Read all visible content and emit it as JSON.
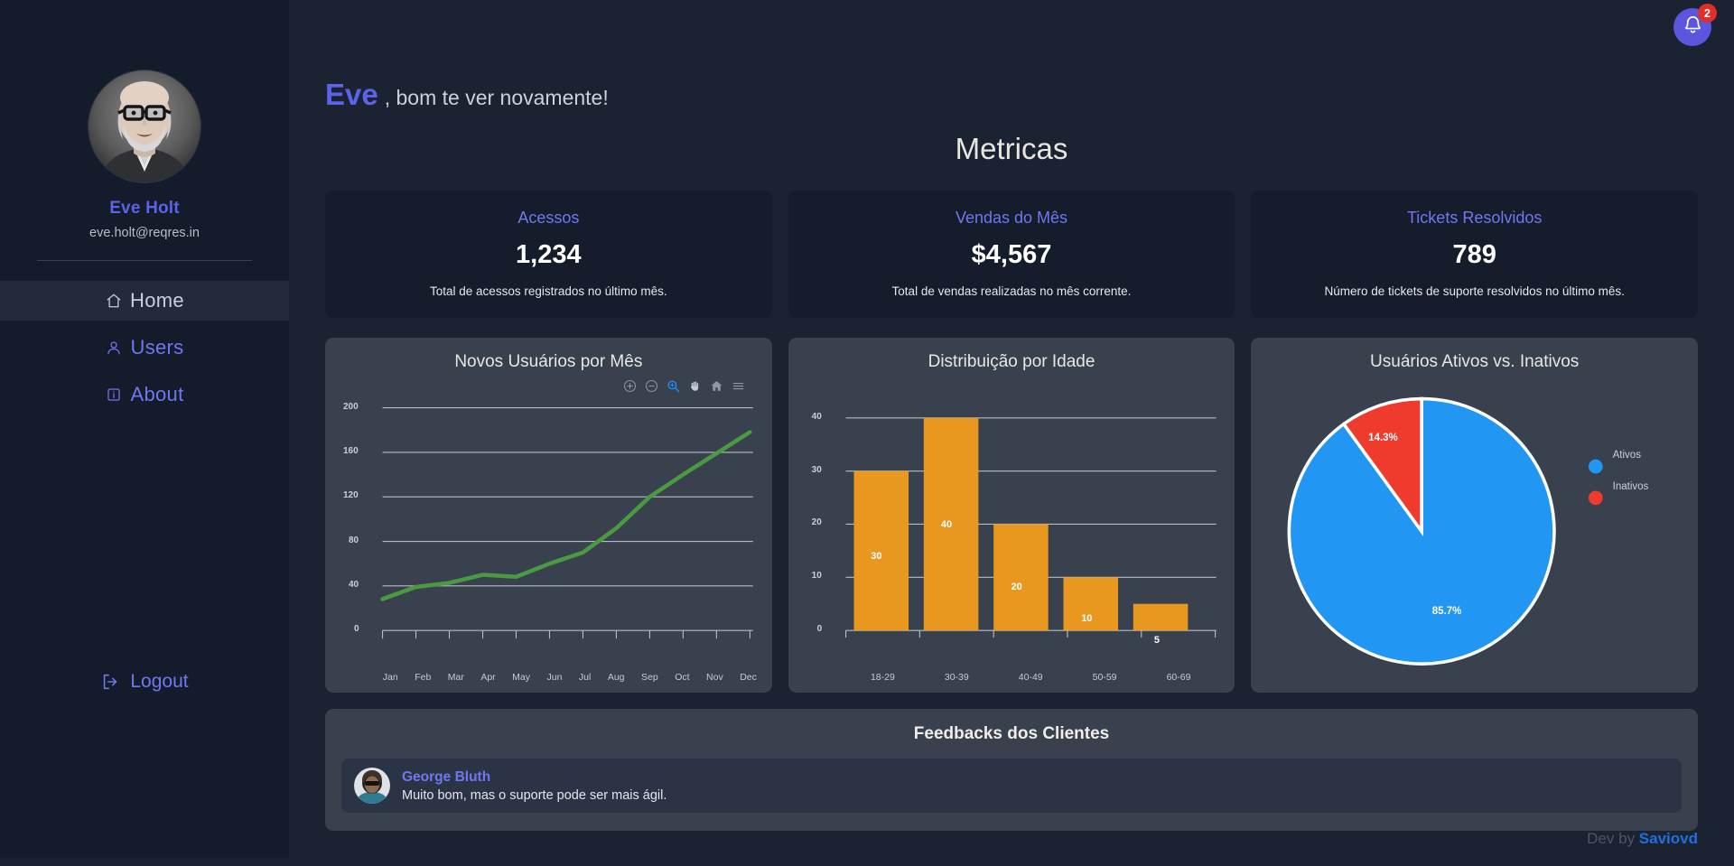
{
  "sidebar": {
    "profile": {
      "name": "Eve Holt",
      "email": "eve.holt@reqres.in",
      "avatar_icon": "user-photo-avatar"
    },
    "nav_items": [
      {
        "label": "Home",
        "icon": "home-icon",
        "active": true
      },
      {
        "label": "Users",
        "icon": "users-icon",
        "active": false
      },
      {
        "label": "About",
        "icon": "info-icon",
        "active": false
      }
    ],
    "logout": {
      "label": "Logout",
      "icon": "logout-icon"
    }
  },
  "header": {
    "greeting_name": "Eve",
    "greeting_rest": ", bom te ver novamente!",
    "page_title": "Metricas",
    "notifications": {
      "icon": "bell-icon",
      "count": "2"
    }
  },
  "metrics": [
    {
      "title": "Acessos",
      "value": "1,234",
      "description": "Total de acessos registrados no último mês."
    },
    {
      "title": "Vendas do Mês",
      "value": "$4,567",
      "description": "Total de vendas realizadas no mês corrente."
    },
    {
      "title": "Tickets Resolvidos",
      "value": "789",
      "description": "Número de tickets de suporte resolvidos no último mês."
    }
  ],
  "chart_titles": {
    "line": "Novos Usuários por Mês",
    "bar": "Distribuição por Idade",
    "pie": "Usuários Ativos vs. Inativos"
  },
  "chart_toolbar": {
    "zoom_in": "zoom-in-icon",
    "zoom_out": "zoom-out-icon",
    "selection_zoom": "selection-zoom-icon",
    "pan": "pan-hand-icon",
    "reset": "home-reset-icon",
    "menu": "hamburger-menu-icon"
  },
  "feedback": {
    "title": "Feedbacks dos Clientes",
    "items": [
      {
        "name": "George Bluth",
        "text": "Muito bom, mas o suporte pode ser mais ágil.",
        "avatar_icon": "user-photo-avatar"
      }
    ]
  },
  "footer": {
    "prefix": "Dev by ",
    "author": "Saviovd"
  },
  "colors": {
    "accent_purple": "#5b63e8",
    "line_green": "#4a9a42",
    "bar_orange": "#e8981f",
    "pie_blue": "#2196f3",
    "pie_red": "#ef3b2d",
    "badge_red": "#e32d29",
    "footer_link": "#1f6fe0"
  },
  "chart_data": [
    {
      "type": "line",
      "title": "Novos Usuários por Mês",
      "xlabel": "",
      "ylabel": "",
      "categories": [
        "Jan",
        "Feb",
        "Mar",
        "Apr",
        "May",
        "Jun",
        "Jul",
        "Aug",
        "Sep",
        "Oct",
        "Nov",
        "Dec"
      ],
      "series": [
        {
          "name": "Novos Usuários",
          "values": [
            28,
            39,
            43,
            50,
            48,
            60,
            70,
            92,
            120,
            140,
            159,
            178
          ]
        }
      ],
      "ylim": [
        0,
        200
      ],
      "yticks": [
        0,
        40,
        80,
        120,
        160,
        200
      ],
      "grid": true,
      "legend": "none",
      "color": "#4a9a42"
    },
    {
      "type": "bar",
      "title": "Distribuição por Idade",
      "xlabel": "",
      "ylabel": "",
      "categories": [
        "18-29",
        "30-39",
        "40-49",
        "50-59",
        "60-69"
      ],
      "values": [
        30,
        40,
        20,
        10,
        5
      ],
      "data_labels": [
        "30",
        "40",
        "20",
        "10",
        "5"
      ],
      "ylim": [
        0,
        40
      ],
      "yticks": [
        0,
        10,
        20,
        30,
        40
      ],
      "grid": true,
      "legend": "none",
      "color": "#e8981f"
    },
    {
      "type": "pie",
      "title": "Usuários Ativos vs. Inativos",
      "labels": [
        "Ativos",
        "Inativos"
      ],
      "values": [
        85.7,
        14.3
      ],
      "data_labels": [
        "85.7%",
        "14.3%"
      ],
      "colors": [
        "#2196f3",
        "#ef3b2d"
      ],
      "legend": "right"
    }
  ]
}
